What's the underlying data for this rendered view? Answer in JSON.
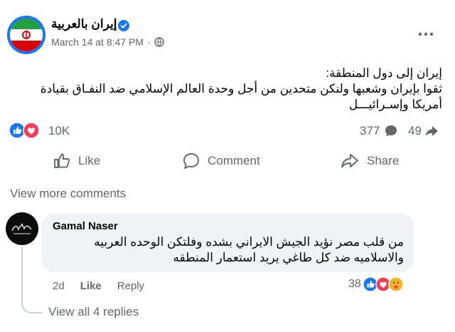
{
  "post": {
    "page_name": "إيران بالعربية",
    "timestamp": "March 14 at 8:47 PM",
    "separator": "·",
    "text_lines": [
      "إيران إلى دول المنطقة:",
      "ثقوا بإيران وشعبها ولنكن متحدين من أجل وحدة العالم الإسلامي ضد النفـاق بقيادة",
      "أمريكا وإسـرائيـــل"
    ],
    "reactions_count": "10K",
    "comments_count": "377",
    "shares_count": "49"
  },
  "actions": {
    "like": "Like",
    "comment": "Comment",
    "share": "Share"
  },
  "view_more_comments": "View more comments",
  "comment": {
    "author": "Gamal Naser",
    "text_lines": [
      "من قلب مصر نؤيد الجيش الايراني بشده وفلتكن الوحده العربيه",
      "والاسلاميه ضد كل طاغي يريد استعمار المنطقه"
    ],
    "age": "2d",
    "like": "Like",
    "reply": "Reply",
    "reactions_count": "38",
    "view_replies": "View all 4 replies"
  },
  "colors": {
    "brand_blue": "#1877f2",
    "love_red": "#f33e58",
    "secondary_text": "#65676b",
    "bubble_bg": "#f0f2f5"
  },
  "icons": [
    "verified-badge-icon",
    "globe-icon",
    "more-options-icon",
    "like-reaction-icon",
    "love-reaction-icon",
    "comment-bubble-icon",
    "share-arrow-icon",
    "thumbs-up-icon",
    "comment-icon",
    "share-icon",
    "care-reaction-icon"
  ]
}
